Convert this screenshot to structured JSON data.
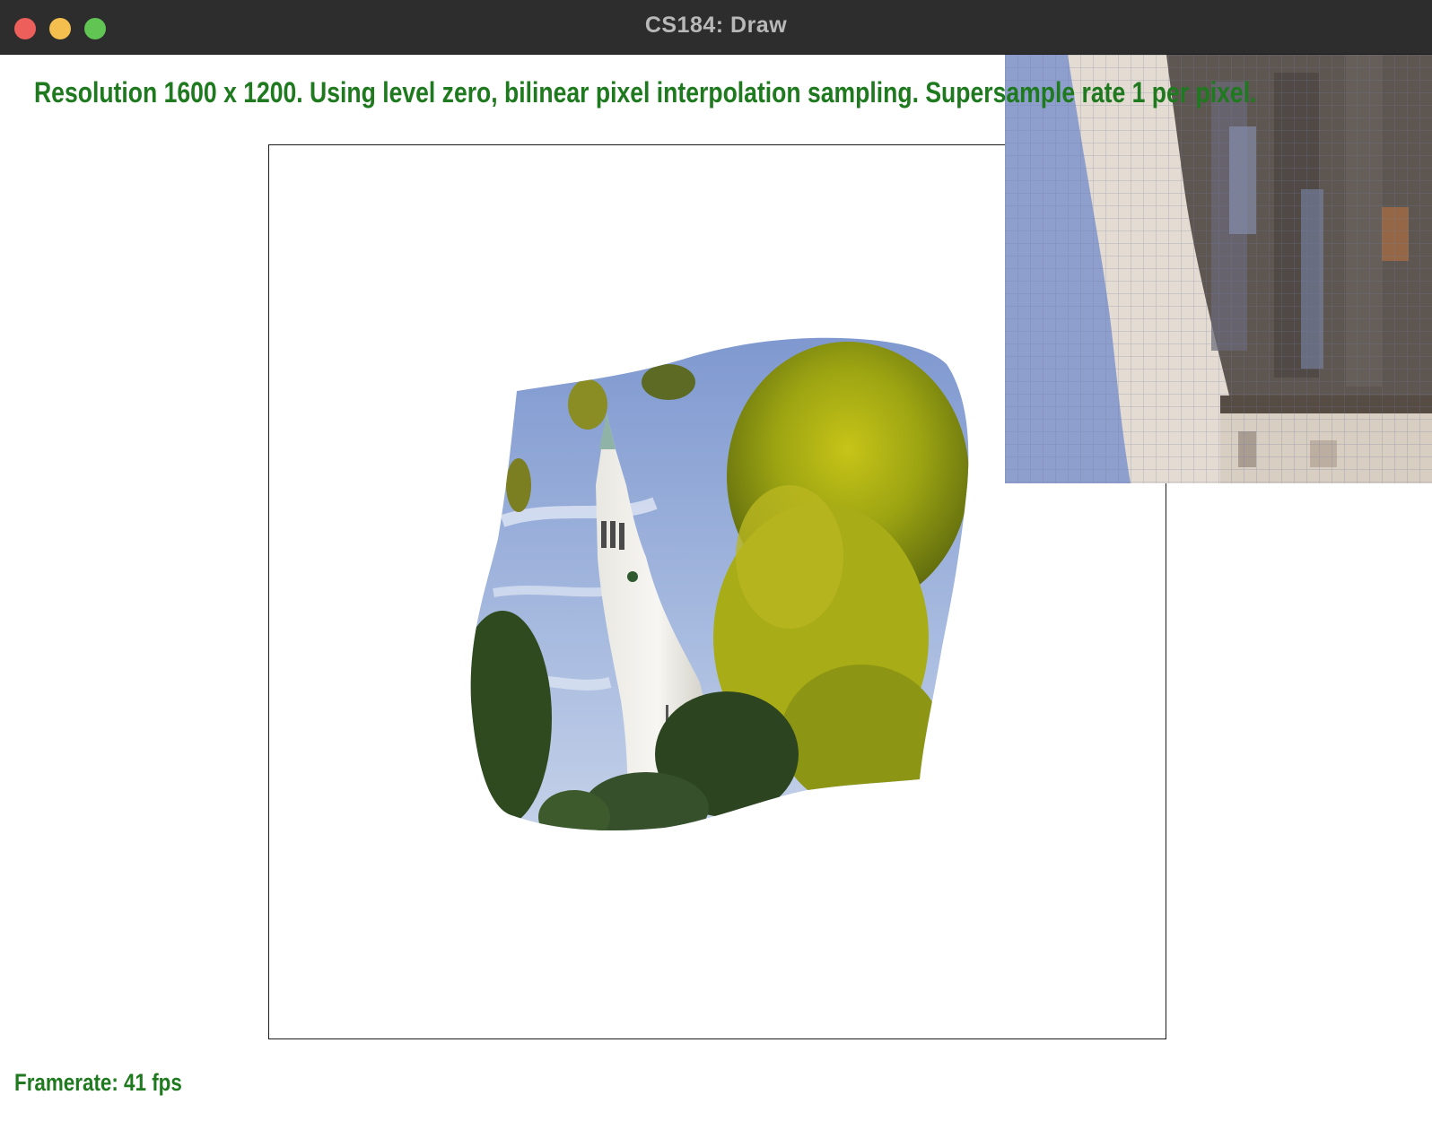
{
  "window": {
    "title": "CS184: Draw",
    "controls": [
      "close",
      "minimize",
      "zoom"
    ]
  },
  "status": {
    "line": "Resolution 1600 x 1200. Using level zero, bilinear pixel interpolation sampling. Supersample rate 1 per pixel.",
    "framerate": "Framerate: 41 fps"
  },
  "colors": {
    "titlebar": "#2d2d2d",
    "status_text": "#1f7a1f",
    "close": "#ec5f5a",
    "minimize": "#f4bf4f",
    "zoom": "#61c554"
  },
  "scene": {
    "subject": "warped photo of a clock tower among trees",
    "zoom_inset": "pixel magnifier"
  }
}
